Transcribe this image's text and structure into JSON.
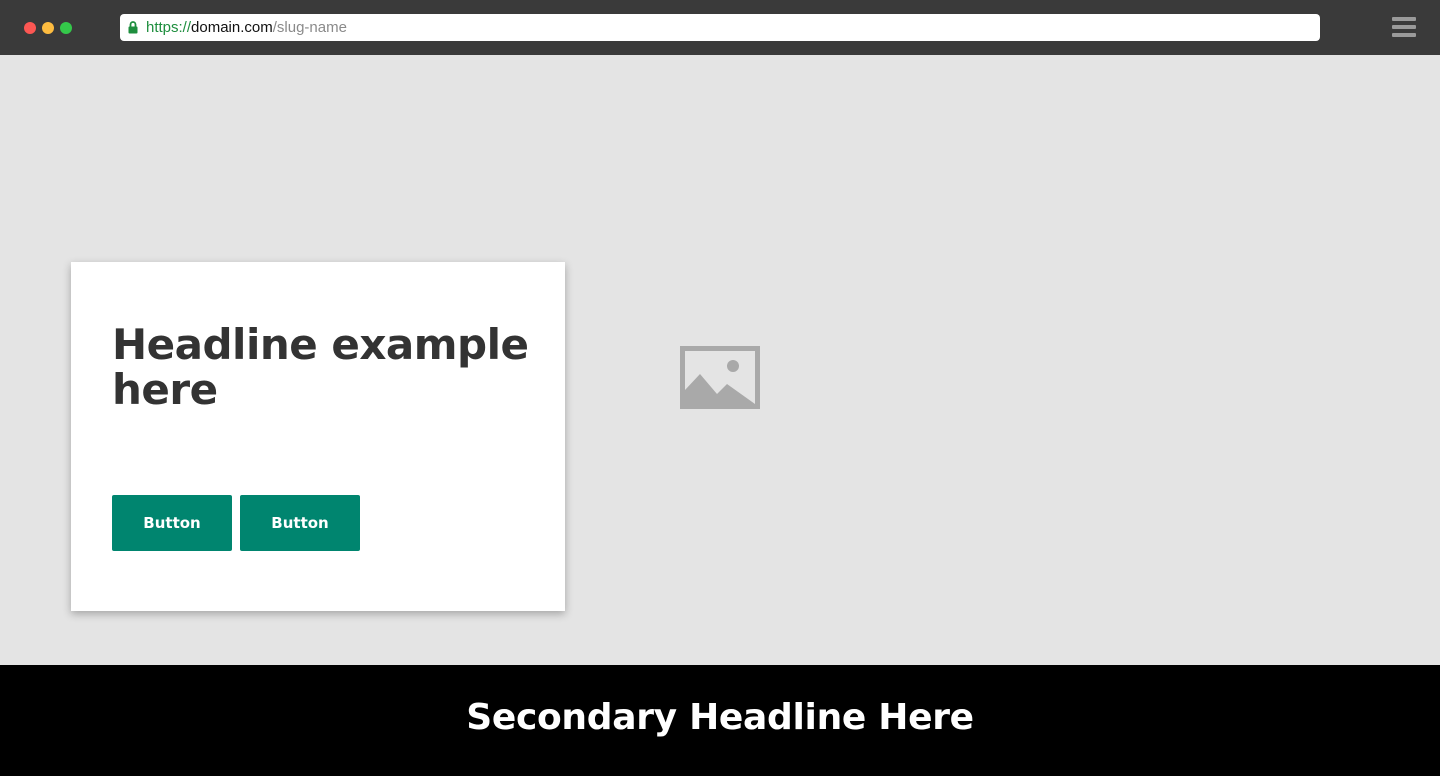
{
  "browser": {
    "url_scheme": "https://",
    "url_host": "domain.com",
    "url_path": "/slug-name"
  },
  "hero": {
    "headline": "Headline example here",
    "buttons": [
      {
        "label": "Button"
      },
      {
        "label": "Button"
      }
    ],
    "image_icon": "image-placeholder-icon"
  },
  "footer": {
    "secondary_headline": "Secondary Headline Here"
  },
  "colors": {
    "chrome": "#3a3a3a",
    "hero_bg": "#e4e4e4",
    "button": "#00856f",
    "headline": "#333333",
    "footer_bg": "#000000"
  }
}
